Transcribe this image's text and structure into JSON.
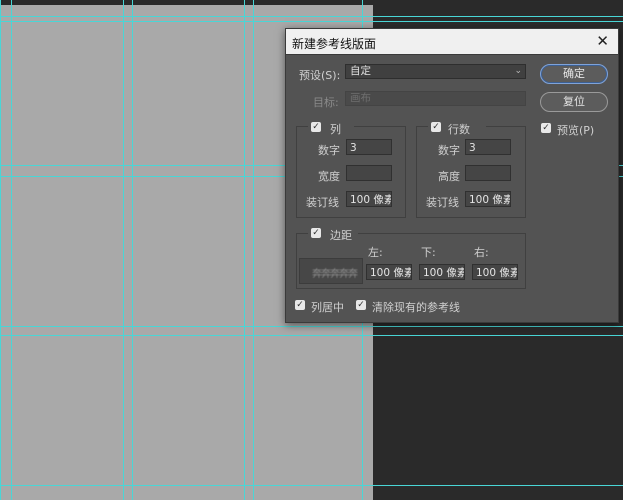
{
  "dialog": {
    "title": "新建参考线版面",
    "preset": {
      "label": "预设(S):",
      "value": "自定"
    },
    "target": {
      "label": "目标:",
      "value": "画布"
    },
    "buttons": {
      "ok": "确定",
      "reset": "复位"
    },
    "preview": {
      "label": "预览(P)",
      "checked": true
    },
    "columns": {
      "label": "列",
      "checked": true,
      "number_label": "数字",
      "number_value": "3",
      "width_label": "宽度",
      "width_value": "",
      "gutter_label": "装订线",
      "gutter_value": "100 像素"
    },
    "rows": {
      "label": "行数",
      "checked": true,
      "number_label": "数字",
      "number_value": "3",
      "height_label": "高度",
      "height_value": "",
      "gutter_label": "装订线",
      "gutter_value": "100 像素"
    },
    "margin": {
      "label": "边距",
      "checked": true,
      "left_label": "左:",
      "left_value": "100 像素",
      "bottom_label": "下:",
      "bottom_value": "100 像素",
      "right_label": "右:",
      "right_value": "100 像素",
      "preview_text": "奔奔奔奔奔"
    },
    "center_columns": {
      "label": "列居中",
      "checked": true
    },
    "clear_guides": {
      "label": "清除现有的参考线",
      "checked": true
    }
  },
  "colors": {
    "guide": "#49d6d6",
    "canvas": "#a9a9a9",
    "workspace": "#2a2a2a",
    "dialog_bg": "#535353"
  },
  "icons": {
    "checkbox": "check-mark",
    "close": "close-x",
    "dropdown": "chevron-down"
  }
}
